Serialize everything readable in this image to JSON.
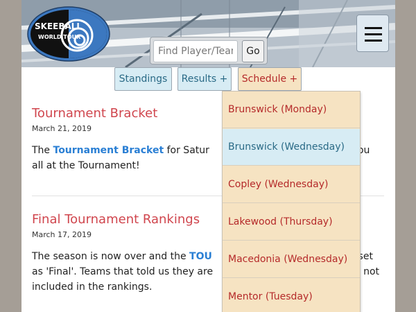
{
  "logo": {
    "line1": "SKEEBALL",
    "line2": "WORLD TOUR"
  },
  "search": {
    "placeholder": "Find Player/Team",
    "button_label": "Go"
  },
  "nav": {
    "standings_label": "Standings",
    "results_label": "Results +",
    "schedule_label": "Schedule +"
  },
  "articles": [
    {
      "title": "Tournament Bracket",
      "date": "March 21, 2019",
      "body_pre": "The ",
      "body_link": "Tournament Bracket",
      "body_mid": " for Satur",
      "body_tail": "ee you",
      "body_line2": "all at the Tournament!"
    },
    {
      "title": "Final Tournament Rankings",
      "date": "March 17, 2019",
      "body_pre": "The season is now over and the ",
      "body_link": "TOU",
      "body_tail": "een set",
      "body_line2": "as 'Final'. Teams that told us they are",
      "body_line2_tail": "are not",
      "body_line3": "included in the rankings."
    }
  ],
  "schedule_menu": [
    {
      "label": "Brunswick (Monday)",
      "active": false
    },
    {
      "label": "Brunswick (Wednesday)",
      "active": true
    },
    {
      "label": "Copley (Wednesday)",
      "active": false
    },
    {
      "label": "Lakewood (Thursday)",
      "active": false
    },
    {
      "label": "Macedonia (Wednesday)",
      "active": false
    },
    {
      "label": "Mentor (Tuesday)",
      "active": false
    }
  ],
  "colors": {
    "page_bg": "#a59e96",
    "title_red": "#d0464e",
    "link_blue": "#2a7fd4",
    "menu_bg": "#f6e3c2",
    "menu_active_bg": "#d7ecf4"
  }
}
